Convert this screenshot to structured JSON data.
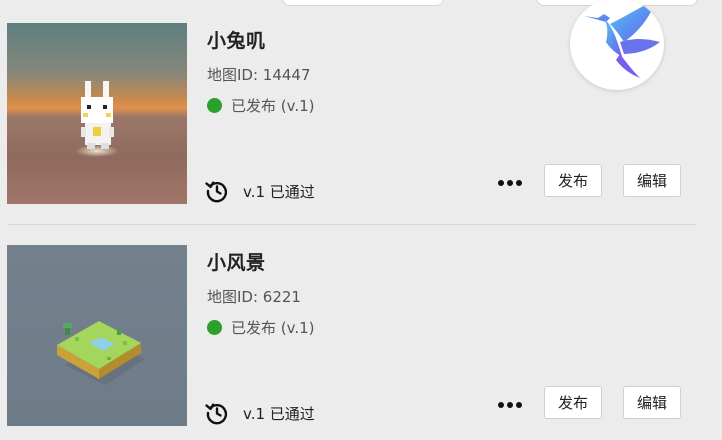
{
  "top_bar": {
    "pill_left": "",
    "pill_right": ""
  },
  "maps": [
    {
      "title": "小兔叽",
      "map_id_label": "地图ID: 14447",
      "status": "已发布 (v.1)",
      "status_color": "#2ca02c",
      "history": "v.1 已通过",
      "publish_label": "发布",
      "edit_label": "编辑",
      "thumbnail": "bunny-voxel-thumbnail"
    },
    {
      "title": "小风景",
      "map_id_label": "地图ID: 6221",
      "status": "已发布 (v.1)",
      "status_color": "#2ca02c",
      "history": "v.1 已通过",
      "publish_label": "发布",
      "edit_label": "编辑",
      "thumbnail": "landscape-voxel-thumbnail"
    }
  ],
  "icons": {
    "history": "history-icon",
    "more": "more-icon",
    "bird": "bird-logo-icon"
  },
  "colors": {
    "background": "#ececec",
    "status_green": "#2ca02c",
    "bird_gradient_start": "#5ec8f0",
    "bird_gradient_end": "#7a5cf0"
  }
}
